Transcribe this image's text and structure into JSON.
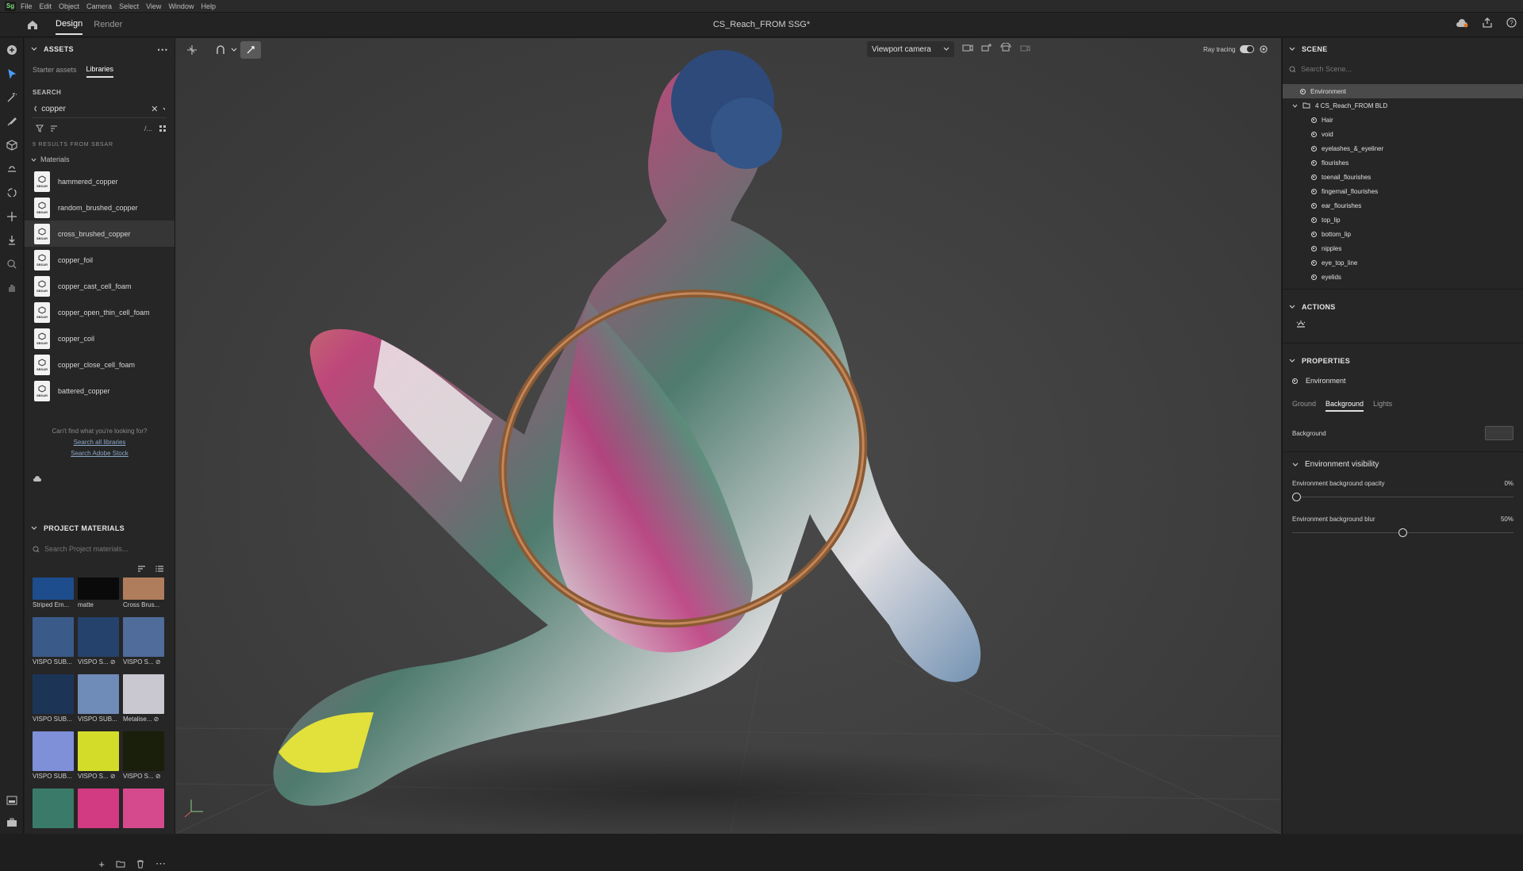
{
  "app": {
    "logo": "Sg",
    "menu": [
      "File",
      "Edit",
      "Object",
      "Camera",
      "Select",
      "View",
      "Window",
      "Help"
    ],
    "tabs": [
      "Design",
      "Render"
    ],
    "document_title": "CS_Reach_FROM SSG*"
  },
  "assets": {
    "header": "ASSETS",
    "subtabs": [
      "Starter assets",
      "Libraries"
    ],
    "search_label": "SEARCH",
    "search_value": "copper",
    "results_label": "9 RESULTS FROM SBSAR",
    "group": "Materials",
    "items": [
      "hammered_copper",
      "random_brushed_copper",
      "cross_brushed_copper",
      "copper_foil",
      "copper_cast_cell_foam",
      "copper_open_thin_cell_foam",
      "copper_coil",
      "copper_close_cell_foam",
      "battered_copper"
    ],
    "sbsar_tag": "SBSAR",
    "cant_find": "Can't find what you're looking for?",
    "link_all": "Search all libraries",
    "link_stock": "Search Adobe Stock"
  },
  "project": {
    "header": "PROJECT MATERIALS",
    "search_placeholder": "Search Project materials...",
    "swatches": [
      {
        "label": "Striped Em...",
        "color": "#1d4d8c"
      },
      {
        "label": "matte",
        "color": "#0a0a0a"
      },
      {
        "label": "Cross Brus...",
        "color": "#b07d5c"
      },
      {
        "label": "VISPO SUB...",
        "color": "#3a5b8a"
      },
      {
        "label": "VISPO S... ⊘",
        "color": "#24426b"
      },
      {
        "label": "VISPO S... ⊘",
        "color": "#4f6c9a"
      },
      {
        "label": "VISPO SUB...",
        "color": "#1c3556"
      },
      {
        "label": "VISPO SUB...",
        "color": "#6f8bb8"
      },
      {
        "label": "Metalise... ⊘",
        "color": "#c9c7cf"
      },
      {
        "label": "VISPO SUB...",
        "color": "#7f8fd8"
      },
      {
        "label": "VISPO S... ⊘",
        "color": "#d4dc2a"
      },
      {
        "label": "VISPO S... ⊘",
        "color": "#1a1f0c"
      },
      {
        "label": "",
        "color": "#3a7a68"
      },
      {
        "label": "",
        "color": "#d23a82"
      },
      {
        "label": "",
        "color": "#d44a8c"
      }
    ]
  },
  "viewport": {
    "camera": "Viewport camera",
    "ray_tracing": "Ray tracing"
  },
  "scene": {
    "header": "SCENE",
    "search_placeholder": "Search Scene...",
    "environment": "Environment",
    "group": "4 CS_Reach_FROM BLD",
    "children": [
      "Hair",
      "void",
      "eyelashes_&_eyeliner",
      "flourishes",
      "toenail_flourishes",
      "fingernail_flourishes",
      "ear_flourishes",
      "top_lip",
      "bottom_lip",
      "nipples",
      "eye_top_line",
      "eyelids"
    ]
  },
  "actions": {
    "header": "ACTIONS"
  },
  "properties": {
    "header": "PROPERTIES",
    "item": "Environment",
    "tabs": [
      "Ground",
      "Background",
      "Lights"
    ],
    "background_label": "Background",
    "visibility_header": "Environment visibility",
    "opacity_label": "Environment background opacity",
    "opacity_value": "0%",
    "opacity_level": 0,
    "blur_label": "Environment background blur",
    "blur_value": "50%",
    "blur_level": 0.5
  }
}
